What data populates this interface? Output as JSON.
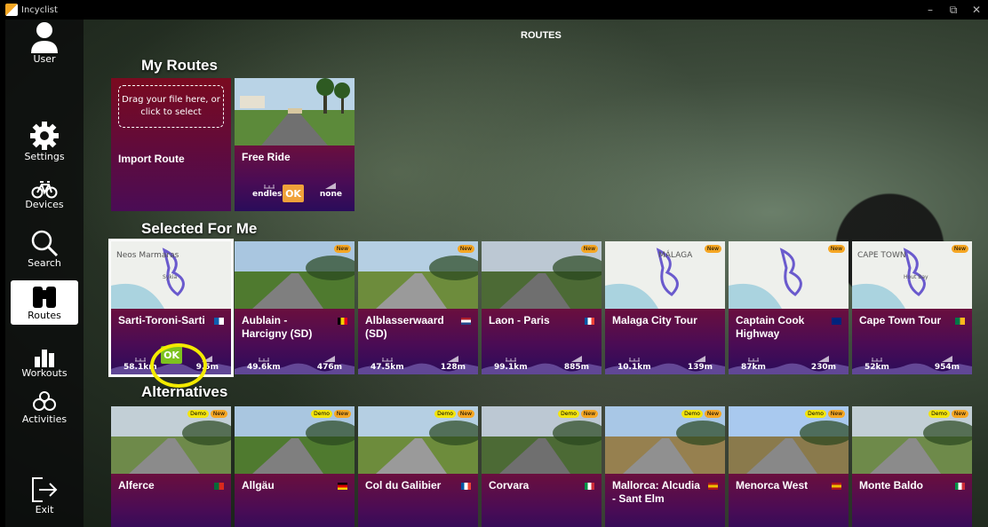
{
  "window": {
    "app_title": "Incyclist",
    "minimize": "–",
    "restore": "⧉",
    "close": "✕"
  },
  "sidebar": {
    "items": [
      {
        "label": "User",
        "icon": "user-icon"
      },
      {
        "label": "Settings",
        "icon": "gear-icon"
      },
      {
        "label": "Devices",
        "icon": "bicycle-icon"
      },
      {
        "label": "Search",
        "icon": "search-icon"
      },
      {
        "label": "Routes",
        "icon": "binoculars-icon",
        "active": true
      },
      {
        "label": "Workouts",
        "icon": "bar-chart-icon"
      },
      {
        "label": "Activities",
        "icon": "activities-icon"
      },
      {
        "label": "Exit",
        "icon": "exit-icon"
      }
    ]
  },
  "page": {
    "title": "ROUTES"
  },
  "sections": {
    "my_routes": "My Routes",
    "selected": "Selected For Me",
    "alternatives": "Alternatives"
  },
  "my_routes": {
    "import": {
      "drop_text": "Drag your file here, or click to select",
      "name": "Import Route"
    },
    "free_ride": {
      "name": "Free Ride",
      "distance": "endless",
      "elevation": "none",
      "ok": "OK"
    }
  },
  "selected_routes": [
    {
      "name": "Sarti-Toroni-Sarti",
      "distance": "58.1km",
      "elevation": "9.5m",
      "flag": "greece",
      "ok": "OK",
      "selected": true,
      "map_label": "Neos Marmaras",
      "map_label2": "Sykia"
    },
    {
      "name": "Aublain - Harcigny (SD)",
      "distance": "49.6km",
      "elevation": "476m",
      "flag": "belgium",
      "badge_new": "New"
    },
    {
      "name": "Alblasserwaard (SD)",
      "distance": "47.5km",
      "elevation": "128m",
      "flag": "netherlands",
      "badge_new": "New"
    },
    {
      "name": "Laon - Paris",
      "distance": "99.1km",
      "elevation": "885m",
      "flag": "france",
      "badge_new": "New"
    },
    {
      "name": "Malaga City Tour",
      "distance": "10.1km",
      "elevation": "139m",
      "flag": "",
      "badge_new": "New",
      "map_label": "MÁLAGA"
    },
    {
      "name": "Captain Cook Highway",
      "distance": "87km",
      "elevation": "230m",
      "flag": "australia",
      "badge_new": "New"
    },
    {
      "name": "Cape Town Tour",
      "distance": "52km",
      "elevation": "954m",
      "flag": "south-africa",
      "badge_new": "New",
      "map_label": "CAPE TOWN",
      "map_label2": "Hout Bay"
    }
  ],
  "alternatives": [
    {
      "name": "Alferce",
      "flag": "portugal",
      "badge_demo": "Demo",
      "badge_new": "New"
    },
    {
      "name": "Allgäu",
      "flag": "germany",
      "badge_demo": "Demo",
      "badge_new": "New"
    },
    {
      "name": "Col du Galibier",
      "flag": "france",
      "badge_demo": "Demo",
      "badge_new": "New"
    },
    {
      "name": "Corvara",
      "flag": "italy",
      "badge_demo": "Demo",
      "badge_new": "New"
    },
    {
      "name": "Mallorca: Alcudia - Sant Elm",
      "flag": "spain",
      "badge_demo": "Demo",
      "badge_new": "New"
    },
    {
      "name": "Menorca West",
      "flag": "spain",
      "badge_demo": "Demo",
      "badge_new": "New"
    },
    {
      "name": "Monte Baldo",
      "flag": "italy",
      "badge_demo": "Demo",
      "badge_new": "New"
    }
  ],
  "colors": {
    "ok_orange": "#f0a23a",
    "ok_green": "#7dc21e",
    "card_purple": "#4a0c55",
    "highlight_yellow": "#f3ea00"
  }
}
